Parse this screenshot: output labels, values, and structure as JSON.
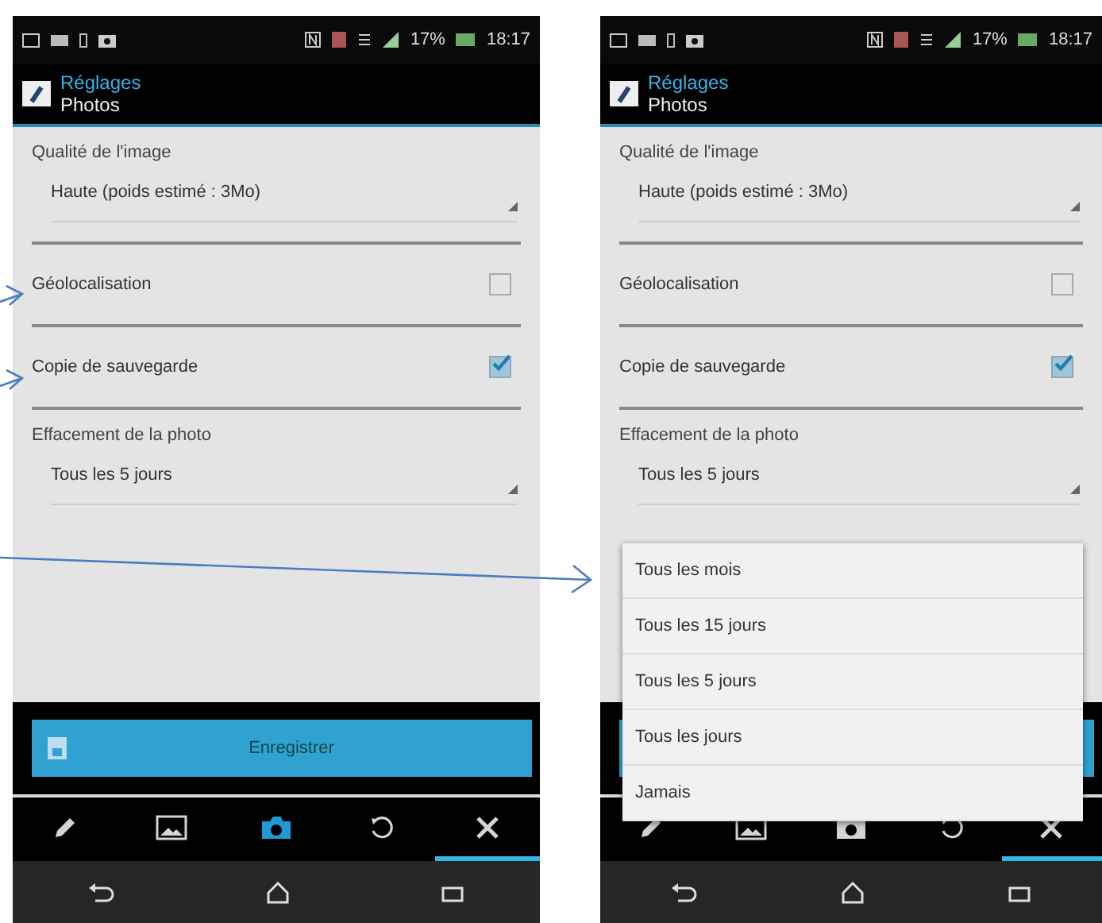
{
  "screens": [
    {
      "status_bar": {
        "battery": "17%",
        "time": "18:17"
      },
      "header": {
        "app": "Réglages",
        "title": "Photos"
      },
      "settings": [
        {
          "kind": "select",
          "label": "Qualité de l'image",
          "value": "Haute (poids estimé : 3Mo)"
        },
        {
          "kind": "checkbox",
          "label": "Géolocalisation",
          "checked": false
        },
        {
          "kind": "checkbox",
          "label": "Copie de sauvegarde",
          "checked": true
        },
        {
          "kind": "select",
          "label": "Effacement de la photo",
          "value": "Tous les 5 jours"
        }
      ],
      "save_button": "Enregistrer",
      "toolbar": [
        {
          "kind": "pencil",
          "highlighted": false,
          "selected": false
        },
        {
          "kind": "picture",
          "highlighted": false,
          "selected": false
        },
        {
          "kind": "camera",
          "highlighted": true,
          "selected": false
        },
        {
          "kind": "undo",
          "highlighted": false,
          "selected": false
        },
        {
          "kind": "tools",
          "highlighted": false,
          "selected": true
        }
      ]
    },
    {
      "status_bar": {
        "battery": "17%",
        "time": "18:17"
      },
      "header": {
        "app": "Réglages",
        "title": "Photos"
      },
      "settings": [
        {
          "kind": "select",
          "label": "Qualité de l'image",
          "value": "Haute (poids estimé : 3Mo)"
        },
        {
          "kind": "checkbox",
          "label": "Géolocalisation",
          "checked": false
        },
        {
          "kind": "checkbox",
          "label": "Copie de sauvegarde",
          "checked": true
        },
        {
          "kind": "select",
          "label": "Effacement de la photo",
          "value": "Tous les 5 jours"
        }
      ],
      "toolbar": [
        {
          "kind": "pencil",
          "selected": false
        },
        {
          "kind": "picture",
          "selected": false
        },
        {
          "kind": "camera",
          "selected": false
        },
        {
          "kind": "undo",
          "selected": false
        },
        {
          "kind": "tools",
          "selected": true
        }
      ],
      "dropdown": {
        "options": [
          "Tous les mois",
          "Tous les 15 jours",
          "Tous les 5 jours",
          "Tous les jours",
          "Jamais"
        ]
      }
    }
  ]
}
